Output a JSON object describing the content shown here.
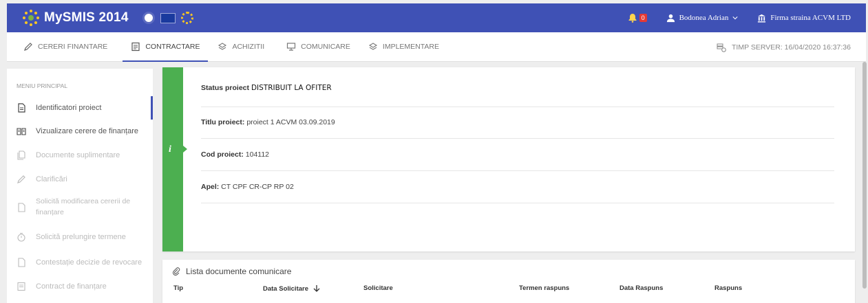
{
  "app": {
    "title": "MySMIS 2014"
  },
  "topbar": {
    "notification_count": "0",
    "user_name": "Bodonea Adrian",
    "company": "Firma straina ACVM LTD"
  },
  "nav": {
    "tabs": [
      {
        "label": "CERERI FINANTARE",
        "icon": "pencil-icon"
      },
      {
        "label": "CONTRACTARE",
        "icon": "contract-icon"
      },
      {
        "label": "ACHIZITII",
        "icon": "layers-icon"
      },
      {
        "label": "COMUNICARE",
        "icon": "monitor-icon"
      },
      {
        "label": "IMPLEMENTARE",
        "icon": "layers-icon"
      }
    ],
    "active_tab": "CONTRACTARE",
    "server_time": "TIMP SERVER: 16/04/2020 16:37:36"
  },
  "sidebar": {
    "title": "MENIU PRINCIPAL",
    "items": [
      {
        "label": "Identificatori proiect",
        "state": "active"
      },
      {
        "label": "Vizualizare cerere de finanțare",
        "state": "enabled"
      },
      {
        "label": "Documente suplimentare",
        "state": "disabled"
      },
      {
        "label": "Clarificări",
        "state": "disabled"
      },
      {
        "label": "Solicită modificarea cererii de finanțare",
        "state": "disabled"
      },
      {
        "label": "Solicită prelungire termene",
        "state": "disabled"
      },
      {
        "label": "Contestație decizie de revocare",
        "state": "disabled"
      },
      {
        "label": "Contract de finanțare",
        "state": "disabled"
      }
    ]
  },
  "project": {
    "status_label": "Status proiect",
    "status_value": "DISTRIBUIT LA OFITER",
    "title_label": "Titlu proiect:",
    "title_value": "proiect 1 ACVM 03.09.2019",
    "code_label": "Cod proiect:",
    "code_value": "104112",
    "call_label": "Apel:",
    "call_value": "CT CPF CR-CP RP 02"
  },
  "documents": {
    "title": "Lista documente comunicare",
    "columns": [
      "Tip",
      "Data Solicitare",
      "Solicitare",
      "Termen raspuns",
      "Data Raspuns",
      "Raspuns"
    ],
    "sort_column": "Data Solicitare"
  },
  "colors": {
    "primary": "#3f51b5",
    "info_strip": "#4caf50",
    "badge": "#e53935"
  }
}
